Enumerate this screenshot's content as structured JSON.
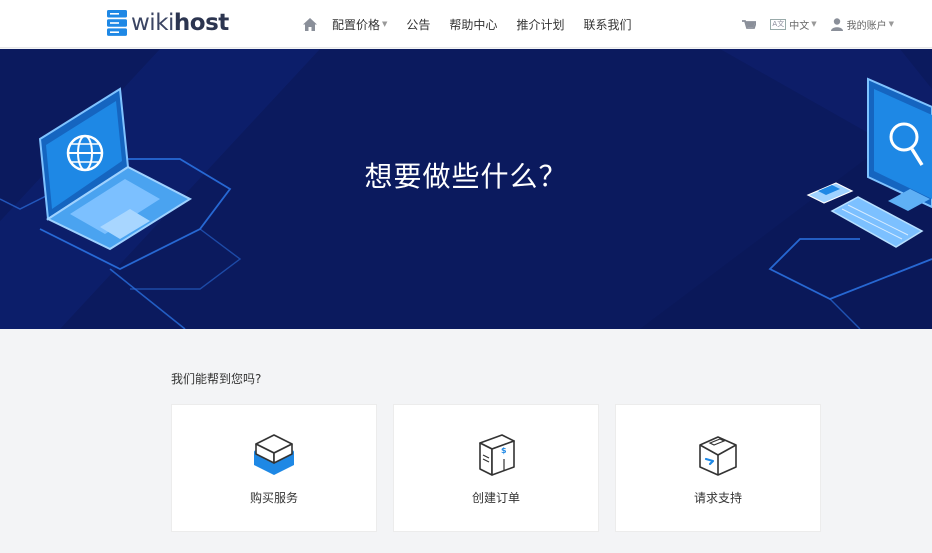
{
  "brand": {
    "light": "wiki",
    "bold": "host"
  },
  "nav": {
    "items": [
      {
        "label": "配置价格",
        "has_caret": true
      },
      {
        "label": "公告"
      },
      {
        "label": "帮助中心"
      },
      {
        "label": "推介计划"
      },
      {
        "label": "联系我们"
      }
    ],
    "language": "中文",
    "language_badge": "A文",
    "account": "我的账户"
  },
  "hero": {
    "title": "想要做些什么？"
  },
  "help": {
    "title": "我们能帮到您吗?",
    "cards": [
      {
        "label": "购买服务",
        "icon": "server-box-icon"
      },
      {
        "label": "创建订单",
        "icon": "package-box-icon"
      },
      {
        "label": "请求支持",
        "icon": "support-box-icon"
      }
    ]
  },
  "colors": {
    "hero_bg": "#0b1a5e",
    "accent": "#1e88e5",
    "page_bg": "#f3f4f6"
  }
}
